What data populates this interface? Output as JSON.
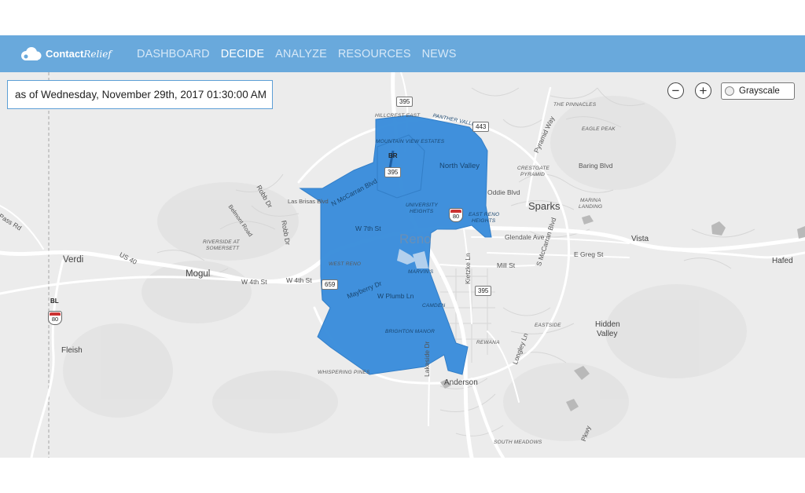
{
  "app": {
    "logo_text": "Contact",
    "logo_script": "Relief"
  },
  "nav": {
    "items": [
      {
        "label": "DASHBOARD",
        "active": false
      },
      {
        "label": "DECIDE",
        "active": true
      },
      {
        "label": "ANALYZE",
        "active": false
      },
      {
        "label": "RESOURCES",
        "active": false
      },
      {
        "label": "NEWS",
        "active": false
      }
    ]
  },
  "timestamp": "as of Wednesday, November 29th, 2017 01:30:00 AM",
  "controls": {
    "zoom_out": "−",
    "zoom_in": "+",
    "map_style": "Grayscale"
  },
  "colors": {
    "nav_bg": "#69a9dc",
    "region_fill": "#3d8fdc",
    "map_bg": "#ececec"
  },
  "map_labels": {
    "reno": "Reno",
    "sparks": "Sparks",
    "verdi": "Verdi",
    "mogul": "Mogul",
    "vista": "Vista",
    "hafed": "Hafed",
    "fleish": "Fleish",
    "anderson": "Anderson",
    "hidden_valley_1": "Hidden",
    "hidden_valley_2": "Valley",
    "oddie_blvd": "Oddie Blvd",
    "baring_blvd": "Baring Blvd",
    "glendale_ave": "Glendale Ave",
    "e_greg_st": "E Greg St",
    "mill_st": "Mill St",
    "w_4th_st_1": "W 4th St",
    "w_4th_st_2": "W 4th St",
    "w_7th_st": "W 7th St",
    "north_valley": "North Valley",
    "mayberry_dr": "Mayberry Dr",
    "w_plumb_ln": "W Plumb Ln",
    "n_mccarran": "N McCarran Blvd",
    "s_mccarran": "S McCarran Blvd",
    "pyramid_way": "Pyramid Way",
    "kietzke_ln": "Kietzke Ln",
    "longley_ln": "Longley Ln",
    "lakeside_dr": "Lakeside Dr",
    "robb_dr_1": "Robb Dr",
    "robb_dr_2": "Robb Dr",
    "las_brisas": "Las Brisas Blvd",
    "belmont_rd": "Belmont Road",
    "pass_rd": "Pass Rd",
    "us40": "US 40",
    "hillcrest_east": "HILLCREST EAST",
    "panther_valley": "PANTHER VALLEY",
    "mountain_view": "MOUNTAIN VIEW ESTATES",
    "university_heights_1": "UNIVERSITY",
    "university_heights_2": "HEIGHTS",
    "east_reno_heights_1": "EAST RENO",
    "east_reno_heights_2": "HEIGHTS",
    "west_reno": "WEST RENO",
    "marvins": "MARVIN'S",
    "camden": "CAMDEN",
    "brighton_manor": "BRIGHTON MANOR",
    "whispering_pines": "WHISPERING PINES",
    "rewana": "REWANA",
    "eastside": "EASTSIDE",
    "south_meadows": "SOUTH MEADOWS",
    "riverside_1": "RIVERSIDE AT",
    "riverside_2": "SOMERSETT",
    "crestgate_1": "CRESTGATE",
    "crestgate_2": "PYRAMID",
    "marina_1": "MARINA",
    "marina_2": "LANDING",
    "eagle_peak": "EAGLE PEAK",
    "the_pinnacles": "THE PINNACLES",
    "pkwy": "Pkwy"
  },
  "shields": {
    "us395_top": "395",
    "us395_mid": "395",
    "us395_south": "395",
    "r443": "443",
    "i80_center": "80",
    "i80_west": "80",
    "r659": "659",
    "br": "BR",
    "bl": "BL"
  }
}
